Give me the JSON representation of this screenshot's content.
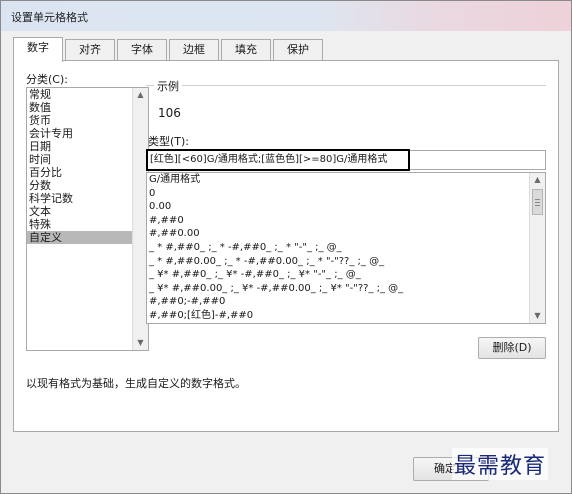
{
  "window": {
    "title": "设置单元格格式"
  },
  "tabs": [
    {
      "label": "数字",
      "active": true
    },
    {
      "label": "对齐",
      "active": false
    },
    {
      "label": "字体",
      "active": false
    },
    {
      "label": "边框",
      "active": false
    },
    {
      "label": "填充",
      "active": false
    },
    {
      "label": "保护",
      "active": false
    }
  ],
  "category": {
    "label": "分类(C):",
    "items": [
      "常规",
      "数值",
      "货币",
      "会计专用",
      "日期",
      "时间",
      "百分比",
      "分数",
      "科学记数",
      "文本",
      "特殊",
      "自定义"
    ],
    "selected": "自定义"
  },
  "sample": {
    "label": "示例",
    "value": "106"
  },
  "type": {
    "label": "类型(T):",
    "value": "[红色][<60]G/通用格式;[蓝色色][>=80]G/通用格式"
  },
  "formats": [
    "G/通用格式",
    "0",
    "0.00",
    "#,##0",
    "#,##0.00",
    "_ * #,##0_ ;_ * -#,##0_ ;_ * \"-\"_ ;_ @_",
    "_ * #,##0.00_ ;_ * -#,##0.00_ ;_ * \"-\"??_ ;_ @_",
    "_ ¥* #,##0_ ;_ ¥* -#,##0_ ;_ ¥* \"-\"_ ;_ @_",
    "_ ¥* #,##0.00_ ;_ ¥* -#,##0.00_ ;_ ¥* \"-\"??_ ;_ @_",
    "#,##0;-#,##0",
    "#,##0;[红色]-#,##0"
  ],
  "buttons": {
    "delete": "删除(D)",
    "ok": "确定"
  },
  "description": "以现有格式为基础，生成自定义的数字格式。",
  "watermark": "最需教育"
}
